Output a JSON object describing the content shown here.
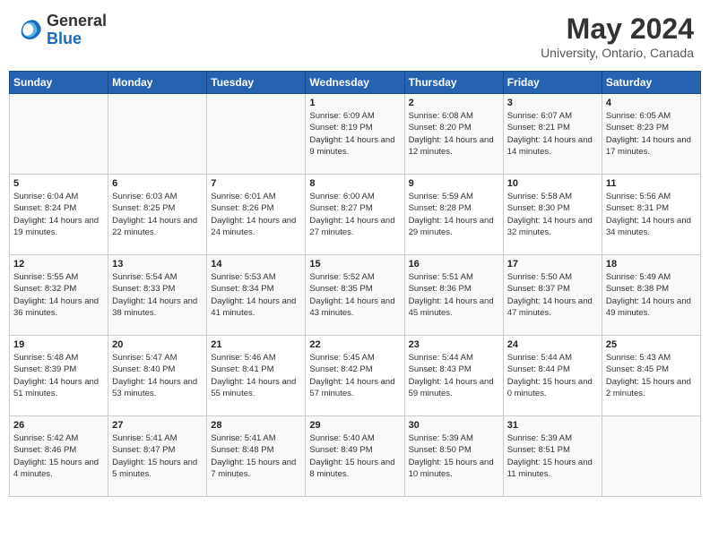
{
  "header": {
    "logo_general": "General",
    "logo_blue": "Blue",
    "title": "May 2024",
    "location": "University, Ontario, Canada"
  },
  "days_of_week": [
    "Sunday",
    "Monday",
    "Tuesday",
    "Wednesday",
    "Thursday",
    "Friday",
    "Saturday"
  ],
  "weeks": [
    [
      {
        "day": "",
        "empty": true
      },
      {
        "day": "",
        "empty": true
      },
      {
        "day": "",
        "empty": true
      },
      {
        "day": "1",
        "sunrise": "6:09 AM",
        "sunset": "8:19 PM",
        "daylight": "14 hours and 9 minutes."
      },
      {
        "day": "2",
        "sunrise": "6:08 AM",
        "sunset": "8:20 PM",
        "daylight": "14 hours and 12 minutes."
      },
      {
        "day": "3",
        "sunrise": "6:07 AM",
        "sunset": "8:21 PM",
        "daylight": "14 hours and 14 minutes."
      },
      {
        "day": "4",
        "sunrise": "6:05 AM",
        "sunset": "8:23 PM",
        "daylight": "14 hours and 17 minutes."
      }
    ],
    [
      {
        "day": "5",
        "sunrise": "6:04 AM",
        "sunset": "8:24 PM",
        "daylight": "14 hours and 19 minutes."
      },
      {
        "day": "6",
        "sunrise": "6:03 AM",
        "sunset": "8:25 PM",
        "daylight": "14 hours and 22 minutes."
      },
      {
        "day": "7",
        "sunrise": "6:01 AM",
        "sunset": "8:26 PM",
        "daylight": "14 hours and 24 minutes."
      },
      {
        "day": "8",
        "sunrise": "6:00 AM",
        "sunset": "8:27 PM",
        "daylight": "14 hours and 27 minutes."
      },
      {
        "day": "9",
        "sunrise": "5:59 AM",
        "sunset": "8:28 PM",
        "daylight": "14 hours and 29 minutes."
      },
      {
        "day": "10",
        "sunrise": "5:58 AM",
        "sunset": "8:30 PM",
        "daylight": "14 hours and 32 minutes."
      },
      {
        "day": "11",
        "sunrise": "5:56 AM",
        "sunset": "8:31 PM",
        "daylight": "14 hours and 34 minutes."
      }
    ],
    [
      {
        "day": "12",
        "sunrise": "5:55 AM",
        "sunset": "8:32 PM",
        "daylight": "14 hours and 36 minutes."
      },
      {
        "day": "13",
        "sunrise": "5:54 AM",
        "sunset": "8:33 PM",
        "daylight": "14 hours and 38 minutes."
      },
      {
        "day": "14",
        "sunrise": "5:53 AM",
        "sunset": "8:34 PM",
        "daylight": "14 hours and 41 minutes."
      },
      {
        "day": "15",
        "sunrise": "5:52 AM",
        "sunset": "8:35 PM",
        "daylight": "14 hours and 43 minutes."
      },
      {
        "day": "16",
        "sunrise": "5:51 AM",
        "sunset": "8:36 PM",
        "daylight": "14 hours and 45 minutes."
      },
      {
        "day": "17",
        "sunrise": "5:50 AM",
        "sunset": "8:37 PM",
        "daylight": "14 hours and 47 minutes."
      },
      {
        "day": "18",
        "sunrise": "5:49 AM",
        "sunset": "8:38 PM",
        "daylight": "14 hours and 49 minutes."
      }
    ],
    [
      {
        "day": "19",
        "sunrise": "5:48 AM",
        "sunset": "8:39 PM",
        "daylight": "14 hours and 51 minutes."
      },
      {
        "day": "20",
        "sunrise": "5:47 AM",
        "sunset": "8:40 PM",
        "daylight": "14 hours and 53 minutes."
      },
      {
        "day": "21",
        "sunrise": "5:46 AM",
        "sunset": "8:41 PM",
        "daylight": "14 hours and 55 minutes."
      },
      {
        "day": "22",
        "sunrise": "5:45 AM",
        "sunset": "8:42 PM",
        "daylight": "14 hours and 57 minutes."
      },
      {
        "day": "23",
        "sunrise": "5:44 AM",
        "sunset": "8:43 PM",
        "daylight": "14 hours and 59 minutes."
      },
      {
        "day": "24",
        "sunrise": "5:44 AM",
        "sunset": "8:44 PM",
        "daylight": "15 hours and 0 minutes."
      },
      {
        "day": "25",
        "sunrise": "5:43 AM",
        "sunset": "8:45 PM",
        "daylight": "15 hours and 2 minutes."
      }
    ],
    [
      {
        "day": "26",
        "sunrise": "5:42 AM",
        "sunset": "8:46 PM",
        "daylight": "15 hours and 4 minutes."
      },
      {
        "day": "27",
        "sunrise": "5:41 AM",
        "sunset": "8:47 PM",
        "daylight": "15 hours and 5 minutes."
      },
      {
        "day": "28",
        "sunrise": "5:41 AM",
        "sunset": "8:48 PM",
        "daylight": "15 hours and 7 minutes."
      },
      {
        "day": "29",
        "sunrise": "5:40 AM",
        "sunset": "8:49 PM",
        "daylight": "15 hours and 8 minutes."
      },
      {
        "day": "30",
        "sunrise": "5:39 AM",
        "sunset": "8:50 PM",
        "daylight": "15 hours and 10 minutes."
      },
      {
        "day": "31",
        "sunrise": "5:39 AM",
        "sunset": "8:51 PM",
        "daylight": "15 hours and 11 minutes."
      },
      {
        "day": "",
        "empty": true
      }
    ]
  ],
  "labels": {
    "sunrise": "Sunrise:",
    "sunset": "Sunset:",
    "daylight": "Daylight:"
  }
}
